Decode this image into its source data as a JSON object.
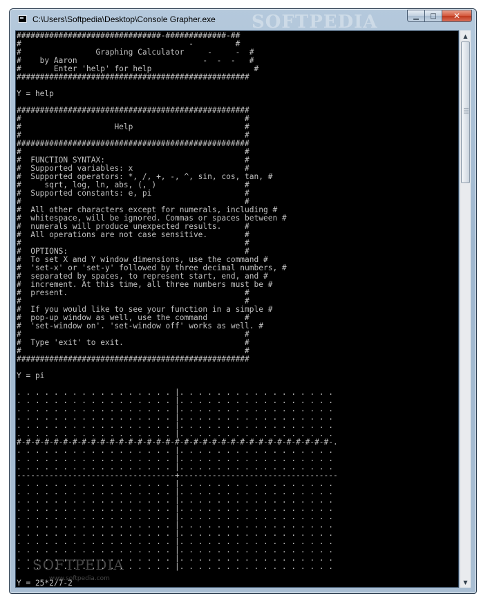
{
  "window": {
    "title": "C:\\Users\\Softpedia\\Desktop\\Console Grapher.exe",
    "controls": {
      "minimize": "▁",
      "maximize": "□",
      "close": "✕"
    }
  },
  "watermark": {
    "title": "SOFTPEDIA",
    "text": "SOFTPEDIA",
    "url": "www.softpedia.com"
  },
  "console": {
    "lines": [
      "###############################-#############-##",
      "#                                    -         #",
      "#                Graphing Calculator     -     -  #",
      "#    by Aaron                           -  -  -   #",
      "#       Enter 'help' for help                      #",
      "##################################################",
      "",
      "Y = help",
      "",
      "##################################################",
      "#                                                #",
      "#                    Help                        #",
      "#                                                #",
      "##################################################",
      "#                                                #",
      "#  FUNCTION SYNTAX:                              #",
      "#  Supported variables: x                        #",
      "#  Supported operators: *, /, +, -, ^, sin, cos, tan, #",
      "#     sqrt, log, ln, abs, (, )                   #",
      "#  Supported constants: e, pi                    #",
      "#                                                #",
      "#  All other characters except for numerals, including #",
      "#  whitespace, will be ignored. Commas or spaces between #",
      "#  numerals will produce unexpected results.     #",
      "#  All operations are not case sensitive.        #",
      "#                                                #",
      "#  OPTIONS:                                      #",
      "#  To set X and Y window dimensions, use the command #",
      "#  'set-x' or 'set-y' followed by three decimal numbers, #",
      "#  separated by spaces, to represent start, end, and #",
      "#  increment. At this time, all three numbers must be #",
      "#  present.                                      #",
      "#                                                #",
      "#  If you would like to see your function in a simple #",
      "#  pop-up window as well, use the command        #",
      "#  'set-window on'. 'set-window off' works as well. #",
      "#                                                #",
      "#  Type 'exit' to exit.                          #",
      "#                                                #",
      "##################################################",
      "",
      "Y = pi",
      "",
      ". . . . . . . . . . . . . . . . . |. . . . . . . . . . . . . . . . .",
      ". . . . . . . . . . . . . . . . . |. . . . . . . . . . . . . . . . .",
      ". . . . . . . . . . . . . . . . . |. . . . . . . . . . . . . . . . .",
      ". . . . . . . . . . . . . . . . . |. . . . . . . . . . . . . . . . .",
      ". . . . . . . . . . . . . . . . . |. . . . . . . . . . . . . . . . .",
      ". . . . . . . . . . . . . . . . . |. . . . . . . . . . . . . . . . .",
      "#-#-#-#-#-#-#-#-#-#-#-#-#-#-#-#-#-#-#-#-#-#-#-#-#-#-#-#-#-#-#-#-#-#-.",
      ". . . . . . . . . . . . . . . . . |. . . . . . . . . . . . . . . . .",
      ". . . . . . . . . . . . . . . . . |. . . . . . . . . . . . . . . . .",
      ". . . . . . . . . . . . . . . . . |. . . . . . . . . . . . . . . . .",
      "----------------------------------+----------------------------------",
      ". . . . . . . . . . . . . . . . . |. . . . . . . . . . . . . . . . .",
      ". . . . . . . . . . . . . . . . . |. . . . . . . . . . . . . . . . .",
      ". . . . . . . . . . . . . . . . . |. . . . . . . . . . . . . . . . .",
      ". . . . . . . . . . . . . . . . . |. . . . . . . . . . . . . . . . .",
      ". . . . . . . . . . . . . . . . . |. . . . . . . . . . . . . . . . .",
      ". . . . . . . . . . . . . . . . . |. . . . . . . . . . . . . . . . .",
      ". . . . . . . . . . . . . . . . . |. . . . . . . . . . . . . . . . .",
      ". . . . . . . . . . . . . . . . . |. . . . . . . . . . . . . . . . .",
      ". . . . . . . . . . . . . . . . . |. . . . . . . . . . . . . . . . .",
      ". . . . . . . . . . . . . . . . . |. . . . . . . . . . . . . . . . .",
      ". . . . . . . . . . . . . . . . . |. . . . . . . . . . . . . . . . .",
      "",
      "Y = 25*2/7-2"
    ]
  }
}
